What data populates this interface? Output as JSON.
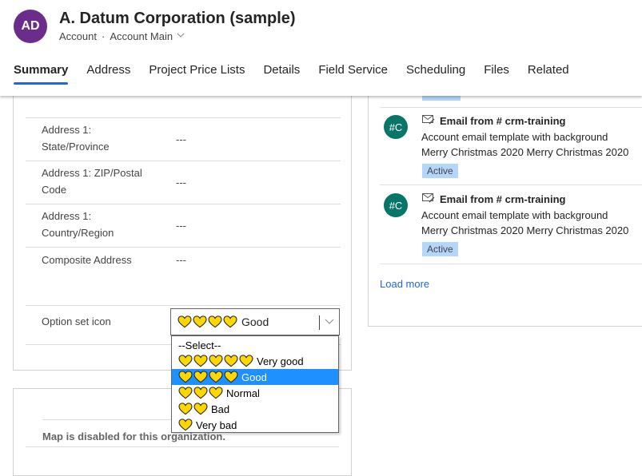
{
  "header": {
    "avatar_initials": "AD",
    "title": "A. Datum Corporation (sample)",
    "entity": "Account",
    "separator": "·",
    "form_name": "Account Main",
    "form_chevron": "chevron-down-icon"
  },
  "tabs": [
    {
      "label": "Summary",
      "active": true
    },
    {
      "label": "Address",
      "active": false
    },
    {
      "label": "Project Price Lists",
      "active": false
    },
    {
      "label": "Details",
      "active": false
    },
    {
      "label": "Field Service",
      "active": false
    },
    {
      "label": "Scheduling",
      "active": false
    },
    {
      "label": "Files",
      "active": false
    },
    {
      "label": "Related",
      "active": false
    }
  ],
  "fields": [
    {
      "label": "Address 1: State/Province",
      "value": "---"
    },
    {
      "label": "Address 1: ZIP/Postal Code",
      "value": "---"
    },
    {
      "label": "Address 1: Country/Region",
      "value": "---"
    },
    {
      "label": "Composite Address",
      "value": "---"
    },
    {
      "label": "Option set icon",
      "value": "Good",
      "hearts": 4
    }
  ],
  "option_set": {
    "selected": "Good",
    "options": [
      {
        "label": "--Select--",
        "hearts": 0
      },
      {
        "label": "Very good",
        "hearts": 5
      },
      {
        "label": "Good",
        "hearts": 4,
        "selected": true
      },
      {
        "label": "Normal",
        "hearts": 3
      },
      {
        "label": "Bad",
        "hearts": 2
      },
      {
        "label": "Very bad",
        "hearts": 1
      }
    ],
    "heart_color": "#FFD700",
    "highlight_color": "#1E90FF"
  },
  "map": {
    "message": "Map is disabled for this organization."
  },
  "timeline": {
    "items": [
      {
        "avatar": "#C",
        "icon": "email-icon",
        "title": "Email from # crm-training",
        "line1": "Account email template with background",
        "line2": "Merry Christmas 2020 Merry Christmas 2020",
        "status": "Active"
      },
      {
        "avatar": "#C",
        "icon": "email-icon",
        "title": "Email from # crm-training",
        "line1": "Account email template with background",
        "line2": "Merry Christmas 2020 Merry Christmas 2020",
        "status": "Active"
      }
    ],
    "load_more": "Load more"
  }
}
